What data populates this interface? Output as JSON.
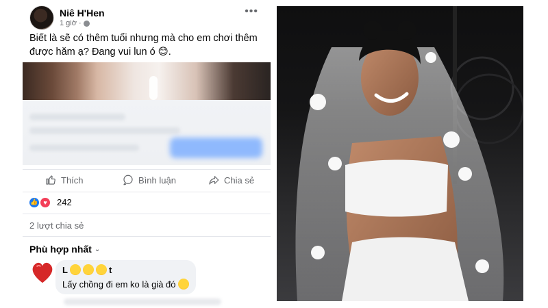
{
  "post": {
    "author": "Niê H'Hen",
    "time": "1 giờ ·",
    "text": "Biết là sẽ có thêm tuổi nhưng mà cho em chơi thêm được hăm ạ? Đang vui lun ó 😊.",
    "more_icon": "more-horizontal-icon"
  },
  "actions": {
    "like": "Thích",
    "comment": "Bình luận",
    "share": "Chia sẻ"
  },
  "reactions": {
    "count": "242",
    "icons": [
      "like-icon",
      "love-icon"
    ]
  },
  "shares": "2 lượt chia sẻ",
  "sort": {
    "label": "Phù hợp nhất"
  },
  "comment": {
    "name": "L",
    "name_suffix": "t",
    "text": "Lấy chồng đi em ko là già đó"
  },
  "colors": {
    "accent": "#1877f2",
    "love": "#f33e58",
    "text_secondary": "#65676b",
    "bubble": "#f0f2f5"
  }
}
